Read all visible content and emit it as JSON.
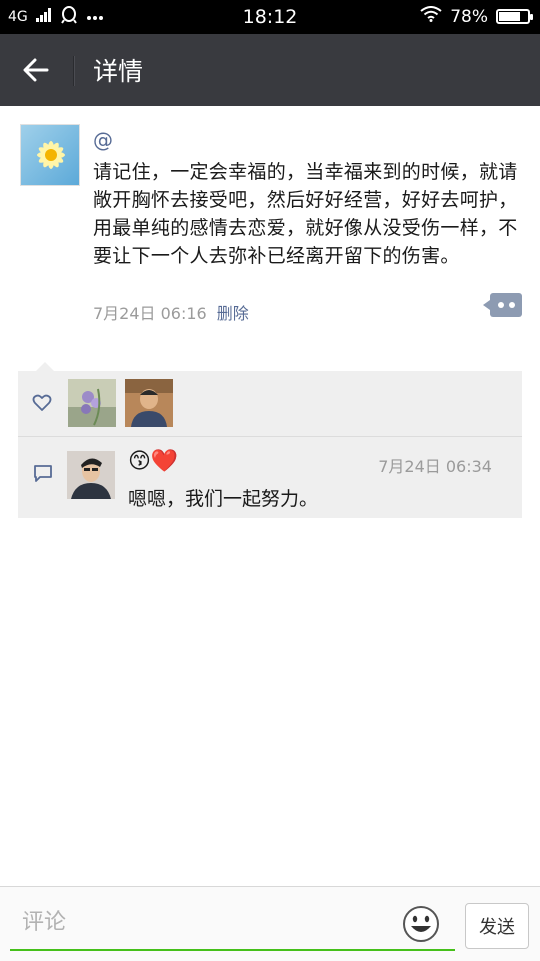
{
  "status_bar": {
    "network": "4G",
    "time": "18:12",
    "battery": "78%",
    "battery_level": 0.78
  },
  "header": {
    "title": "详情"
  },
  "post": {
    "mention": "@",
    "text": "请记住，一定会幸福的，当幸福来到的时候，就请敞开胸怀去接受吧，然后好好经营，好好去呵护，用最单纯的感情去恋爱，就好像从没受伤一样，不要让下一个人去弥补已经离开留下的伤害。",
    "time": "7月24日 06:16",
    "delete_label": "删除"
  },
  "likes": {
    "avatars": [
      "purple-flower-avatar",
      "man-portrait-avatar"
    ]
  },
  "comments": [
    {
      "emoji": "😙❤️",
      "time": "7月24日 06:34",
      "text": "嗯嗯，我们一起努力。"
    }
  ],
  "input": {
    "placeholder": "评论",
    "send_label": "发送"
  }
}
